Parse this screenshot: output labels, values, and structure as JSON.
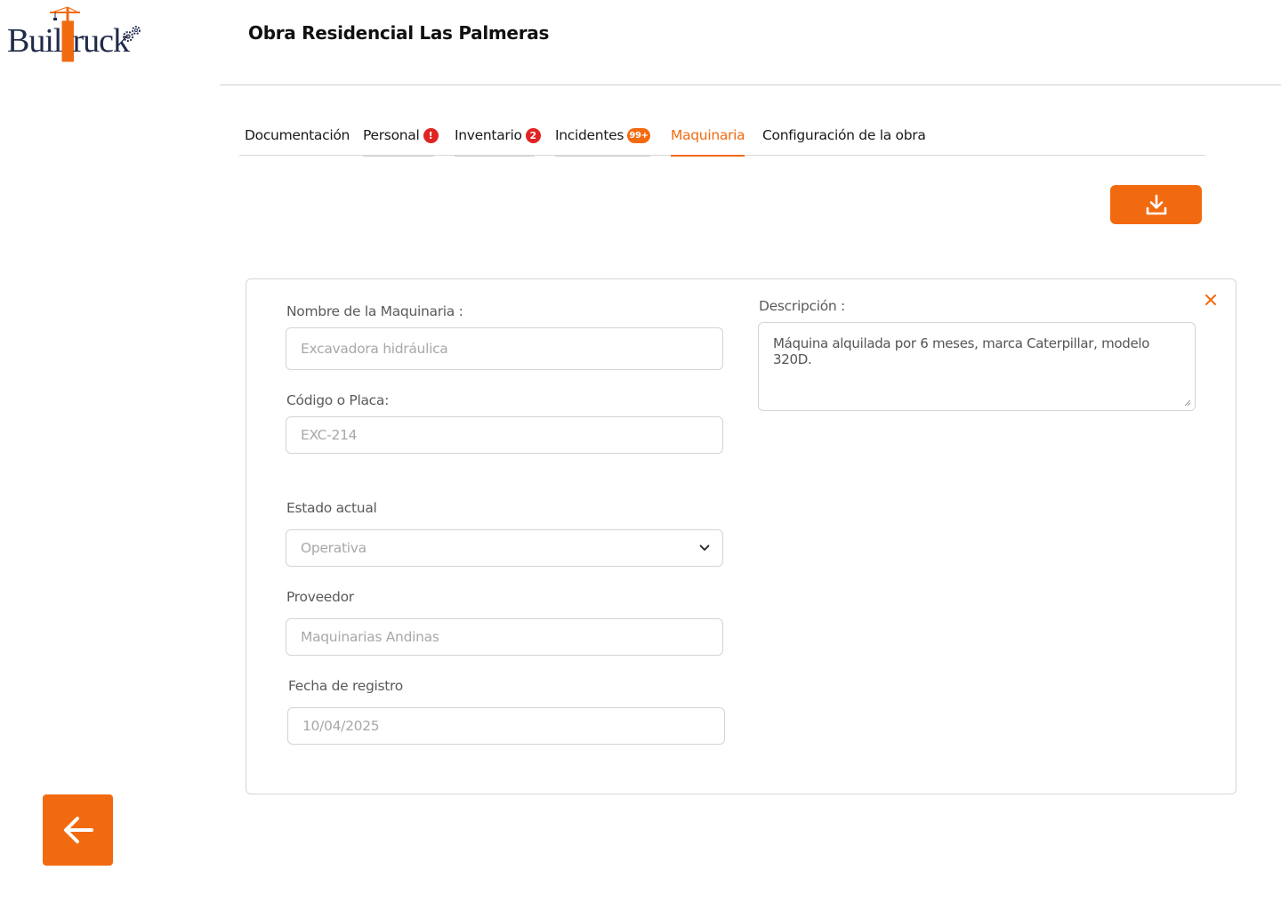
{
  "brand": {
    "logo_text_left": "Buil",
    "logo_text_right": "ruck",
    "primary_color": "#f26a10",
    "navy_color": "#1f2a4a"
  },
  "header": {
    "title": "Obra Residencial Las Palmeras"
  },
  "tabs": [
    {
      "label": "Documentación"
    },
    {
      "label": "Personal",
      "badge": "!"
    },
    {
      "label": "Inventario",
      "badge": "2"
    },
    {
      "label": "Incidentes",
      "badge": "99+"
    },
    {
      "label": "Maquinaria",
      "active": true
    },
    {
      "label": "Configuración de la obra"
    }
  ],
  "toolbar": {
    "download_icon": "download-icon"
  },
  "form": {
    "name": {
      "label": "Nombre de la Maquinaria :",
      "value": "Excavadora hidráulica"
    },
    "code": {
      "label": "Código o Placa:",
      "value": "EXC-214"
    },
    "status": {
      "label": "Estado actual",
      "value": "Operativa"
    },
    "supplier": {
      "label": "Proveedor",
      "value": "Maquinarias Andinas"
    },
    "date": {
      "label": "Fecha de registro",
      "value": "10/04/2025"
    },
    "description": {
      "label": "Descripción :",
      "value": "Máquina alquilada por 6 meses, marca Caterpillar, modelo 320D."
    }
  },
  "icons": {
    "close": "close-icon",
    "back": "arrow-left-icon",
    "dropdown": "chevron-down-icon"
  }
}
